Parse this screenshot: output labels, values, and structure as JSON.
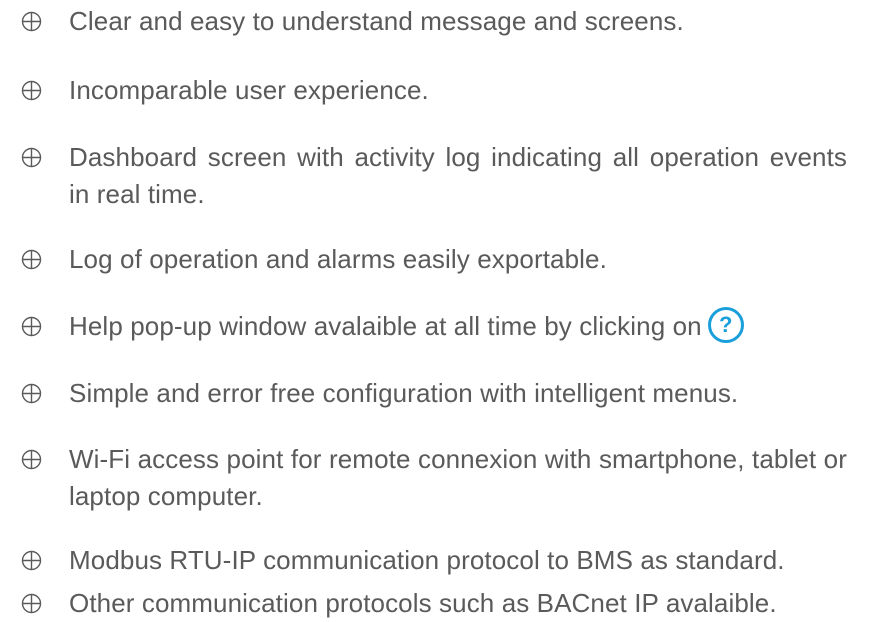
{
  "features": [
    {
      "text": "Clear and easy to understand message and screens."
    },
    {
      "text": "Incomparable user experience."
    },
    {
      "text": "Dashboard screen with activity log indicating all operation events in real time."
    },
    {
      "text": "Log of operation and alarms easily exportable."
    },
    {
      "text": "Help pop-up window avalaible at all time by clicking on",
      "icon": "help-question-icon",
      "icon_glyph": "?"
    },
    {
      "text": "Simple and error free configuration with intelligent menus."
    },
    {
      "text": "Wi-Fi access point for remote connexion with smartphone, tablet or laptop computer."
    },
    {
      "text": "Modbus RTU-IP communication protocol to BMS as standard."
    },
    {
      "text": "Other communication protocols such as BACnet IP avalaible."
    }
  ],
  "bullet_icon": "circled-plus-icon",
  "colors": {
    "text": "#5a5a5a",
    "bullet": "#5a5a5a",
    "help_icon": "#1a9fdb"
  }
}
